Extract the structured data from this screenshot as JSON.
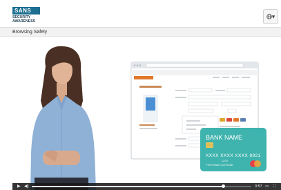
{
  "header": {
    "logo": {
      "line1": "SANS",
      "line2": "SECURITY",
      "line3": "AWARENESS"
    },
    "language_icon": "globe-icon",
    "language_caret": "▾"
  },
  "lesson": {
    "title": "Browsing Safely"
  },
  "video": {
    "card": {
      "bank_name": "BANK NAME",
      "number": "XXXX XXXX XXXX 8921",
      "expiry": "12/30",
      "holder": "FIRSTNAME LASTNAME"
    },
    "controls": {
      "play_icon": "play-icon",
      "volume_icon": "volume-icon",
      "progress": 0.87,
      "time": "0:57",
      "captions_icon": "captions-icon",
      "fullscreen_icon": "fullscreen-icon"
    }
  },
  "colors": {
    "brand": "#1d6f92",
    "card": "#3fb3ad",
    "browser_accent": "#e0782b",
    "shirt": "#8fb1d6"
  }
}
